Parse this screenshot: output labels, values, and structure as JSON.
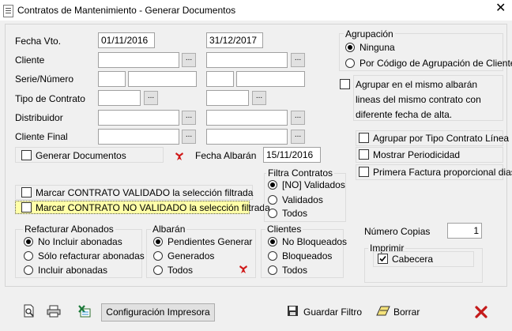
{
  "window": {
    "title": "Contratos de Mantenimiento - Generar Documentos",
    "close": "✕"
  },
  "labels": {
    "fecha_vto": "Fecha Vto.",
    "cliente": "Cliente",
    "serie": "Serie/Número",
    "tipo_contrato": "Tipo de Contrato",
    "distribuidor": "Distribuidor",
    "cliente_final": "Cliente Final",
    "fecha_albaran": "Fecha Albarán",
    "numero_copias": "Número Copias"
  },
  "values": {
    "fecha_desde": "01/11/2016",
    "fecha_hasta": "31/12/2017",
    "fecha_albaran": "15/11/2016",
    "numero_copias": "1",
    "dots": "..."
  },
  "checks": {
    "generar_documentos": "Generar Documentos",
    "marcar_validado": "Marcar CONTRATO  VALIDADO la selección filtrada",
    "marcar_no_validado": "Marcar CONTRATO NO VALIDADO la selección filtrada",
    "agrupar_albaran": "Agrupar en el mismo albarán lineas del mismo contrato con diferente fecha de alta.",
    "agrupar_tipo": "Agrupar por Tipo Contrato Línea",
    "mostrar_periodicidad": "Mostrar Periodicidad",
    "primera_factura": "Primera Factura proporcional dias",
    "cabecera": "Cabecera"
  },
  "groups": {
    "agrupacion": {
      "title": "Agrupación",
      "options": [
        "Ninguna",
        "Por Código de Agrupación de Cliente"
      ]
    },
    "filtra": {
      "title": "Filtra Contratos",
      "options": [
        "[NO] Validados",
        "Validados",
        "Todos"
      ]
    },
    "refacturar": {
      "title": "Refacturar Abonados",
      "options": [
        "No Incluir abonadas",
        "Sólo refacturar abonadas",
        "Incluir abonadas"
      ]
    },
    "albaran": {
      "title": "Albarán",
      "options": [
        "Pendientes Generar",
        "Generados",
        "Todos"
      ]
    },
    "clientes": {
      "title": "Clientes",
      "options": [
        "No Bloqueados",
        "Bloqueados",
        "Todos"
      ]
    },
    "imprimir": {
      "title": "Imprimir"
    }
  },
  "toolbar": {
    "config": "Configuración Impresora",
    "guardar": "Guardar Filtro",
    "borrar": "Borrar"
  }
}
